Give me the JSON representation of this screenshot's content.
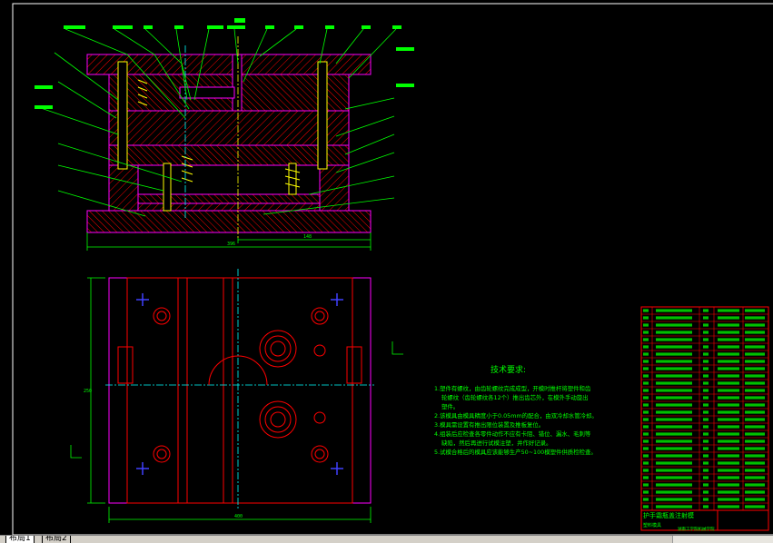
{
  "drawing": {
    "header_mark": "",
    "tech_title": "技术要求:",
    "tech_notes": [
      "1.塑件有螺纹，由齿轮螺纹完成成型，开模时推杆将塑件和齿",
      "轮螺纹（齿轮螺纹各12个）推出齿芯外，在模外手动旋出",
      "塑件。",
      "2.该模具由模具精度小于0.05mm的配合，由双冷却水管冷却。",
      "3.模具需设置有推出限位装置及推板复位。",
      "4.组装后应检查各零件动作不应有卡阻、错位、漏水、毛刺等",
      "缺陷，然后再进行试模注塑，并作好记录。",
      "5.试模合格后的模具应该能够生产50~100模塑件供质检检查。"
    ],
    "dim_total_width": "396",
    "dim_partial_width": "148",
    "dim_plan_width": "400",
    "dim_plan_height": "250",
    "title_block_name": "护手霜瓶盖注射模",
    "title_block_sub": "塑料模具",
    "title_block_footer": "湖南工学院机械学院"
  },
  "tabs": [
    {
      "label": "布局1",
      "active": true
    },
    {
      "label": "布局2",
      "active": false
    }
  ]
}
